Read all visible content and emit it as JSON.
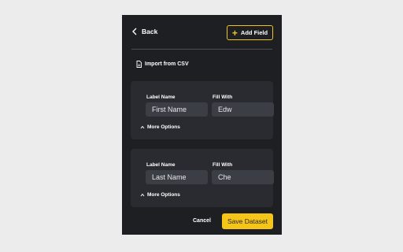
{
  "header": {
    "back_label": "Back",
    "add_field_label": "Add Field"
  },
  "import_label": "Import from CSV",
  "fields": [
    {
      "label_name_title": "Label Name",
      "label_name_value": "First Name",
      "fill_with_title": "Fill With",
      "fill_with_value": "Edw",
      "more_options_label": "More Options"
    },
    {
      "label_name_title": "Label Name",
      "label_name_value": "Last Name",
      "fill_with_title": "Fill With",
      "fill_with_value": "Che",
      "more_options_label": "More Options"
    }
  ],
  "footer": {
    "cancel_label": "Cancel",
    "save_label": "Save Dataset"
  },
  "colors": {
    "accent": "#f5c518",
    "panel_bg": "#1e1f22",
    "card_bg": "#2a2b30",
    "input_bg": "#3c3e45"
  }
}
